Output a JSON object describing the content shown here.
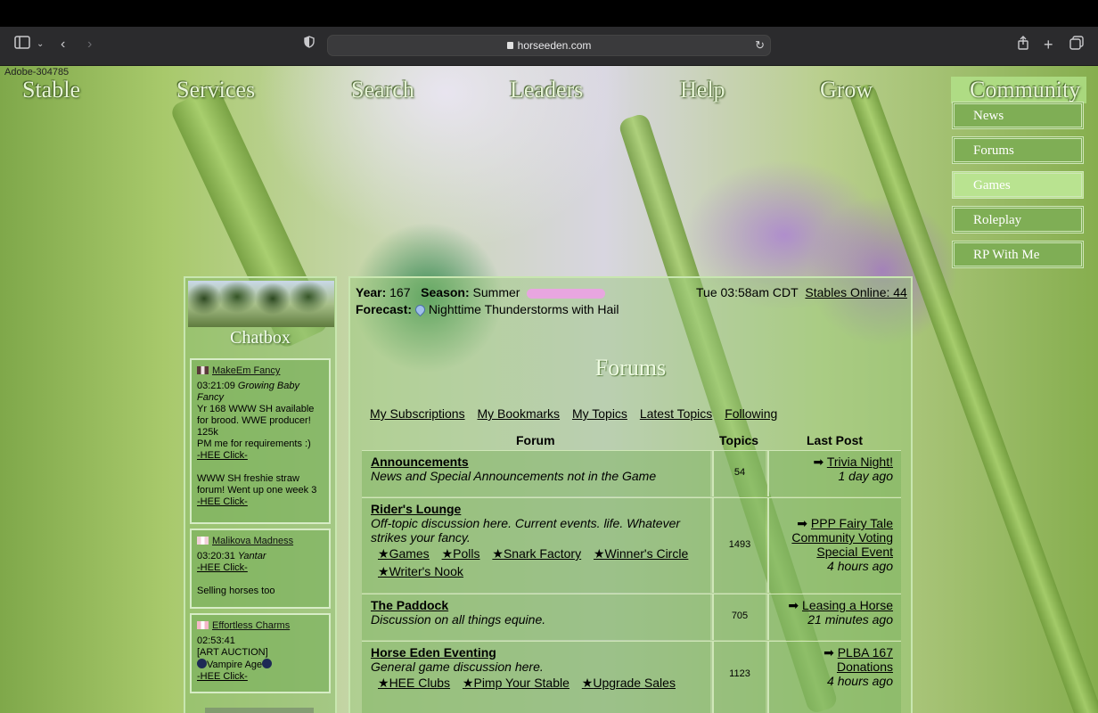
{
  "browser": {
    "url": "horseeden.com"
  },
  "page": {
    "watermark": "Adobe-304785"
  },
  "nav": {
    "items": [
      "Stable",
      "Services",
      "Search",
      "Leaders",
      "Help",
      "Grow",
      "Community"
    ],
    "community_menu": [
      "News",
      "Forums",
      "Games",
      "Roleplay",
      "RP With Me"
    ],
    "active_menu_item": "Games"
  },
  "chatbox": {
    "title": "Chatbox",
    "messages": [
      {
        "user": "MakeEm Fancy",
        "time": "03:21:09",
        "horse": "Growing Baby Fancy",
        "lines": [
          "Yr 168 WWW SH available for brood. WWE producer! 125k",
          "PM me for requirements :)"
        ],
        "link": "-HEE Click-",
        "extra": "WWW SH freshie straw forum! Went up one week 3",
        "link2": "-HEE Click-"
      },
      {
        "user": "Malikova Madness",
        "time": "03:20:31",
        "horse": "Yantar",
        "link": "-HEE Click-",
        "extra": "Selling horses too"
      },
      {
        "user": "Effortless Charms",
        "time": "02:53:41",
        "line1": "[ART AUCTION]",
        "line2": "Vampire Age",
        "link": "-HEE Click-"
      }
    ]
  },
  "status": {
    "year_label": "Year:",
    "year": "167",
    "season_label": "Season:",
    "season": "Summer",
    "time": "Tue 03:58am CDT",
    "stables_online": "Stables Online: 44",
    "forecast_label": "Forecast:",
    "forecast": "Nighttime Thunderstorms with Hail"
  },
  "forums": {
    "title": "Forums",
    "links": [
      "My Subscriptions",
      "My Bookmarks",
      "My Topics",
      "Latest Topics",
      "Following"
    ],
    "columns": [
      "Forum",
      "Topics",
      "Last Post"
    ],
    "rows": [
      {
        "name": "Announcements",
        "desc": "News and Special Announcements not in the Game",
        "topics": "54",
        "last": "Trivia Night!",
        "when": "1 day ago"
      },
      {
        "name": "Rider's Lounge",
        "desc": "Off-topic discussion here. Current events. life. Whatever strikes your fancy.",
        "subforums": [
          "Games",
          "Polls",
          "Snark Factory",
          "Winner's Circle",
          "Writer's Nook"
        ],
        "topics": "1493",
        "last": "PPP Fairy Tale Community Voting Special Event",
        "when": "4 hours ago"
      },
      {
        "name": "The Paddock",
        "desc": "Discussion on all things equine.",
        "topics": "705",
        "last": "Leasing a Horse",
        "when": "21 minutes ago"
      },
      {
        "name": "Horse Eden Eventing",
        "desc": "General game discussion here.",
        "subforums": [
          "HEE Clubs",
          "Pimp Your Stable",
          "Upgrade Sales"
        ],
        "topics": "1123",
        "last": "PLBA 167 Donations",
        "when": "4 hours ago"
      }
    ]
  }
}
